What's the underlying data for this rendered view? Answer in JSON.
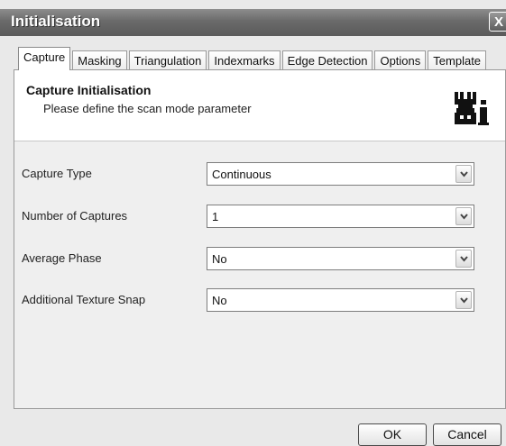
{
  "window": {
    "title": "Initialisation",
    "close_glyph": "X"
  },
  "tabs": [
    {
      "label": "Capture",
      "active": true
    },
    {
      "label": "Masking"
    },
    {
      "label": "Triangulation"
    },
    {
      "label": "Indexmarks"
    },
    {
      "label": "Edge Detection"
    },
    {
      "label": "Options"
    },
    {
      "label": "Template"
    }
  ],
  "header": {
    "title": "Capture Initialisation",
    "subtitle": "Please define the scan mode parameter",
    "icon": "wizard-icon"
  },
  "fields": [
    {
      "label": "Capture Type",
      "value": "Continuous"
    },
    {
      "label": "Number of Captures",
      "value": "1"
    },
    {
      "label": "Average Phase",
      "value": "No"
    },
    {
      "label": "Additional Texture Snap",
      "value": "No"
    }
  ],
  "buttons": {
    "ok": "OK",
    "cancel": "Cancel"
  }
}
